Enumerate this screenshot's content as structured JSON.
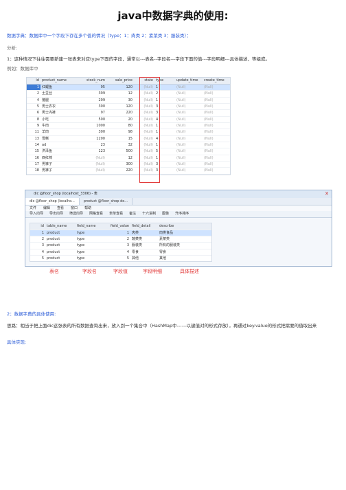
{
  "title": "java中数据字典的使用:",
  "intro": "数据字典：数据库中一个字段下存在多个值的情况（type：1：肉类 2：素菜类 3：服装类）：",
  "analysis_label": "分析:",
  "analysis_text": "1：这种情况下往往需要新建一张表来对应type下面的字段，通常以---表名--字段名---字段下面的值---字段明细---具体描述，等组成。",
  "example_label": "例如：数据库中",
  "table1": {
    "columns": [
      "id",
      "product_name",
      "stock_num",
      "sale_price",
      "state",
      "type",
      "update_time",
      "create_time"
    ],
    "rows": [
      [
        "1",
        "红鲤鱼",
        "95",
        "120",
        "(Null)",
        "1",
        "(Null)",
        "(Null)"
      ],
      [
        "2",
        "土豆丝",
        "399",
        "12",
        "(Null)",
        "2",
        "(Null)",
        "(Null)"
      ],
      [
        "4",
        "猪腿",
        "299",
        "30",
        "(Null)",
        "1",
        "(Null)",
        "(Null)"
      ],
      [
        "5",
        "男士衣衣",
        "300",
        "120",
        "(Null)",
        "3",
        "(Null)",
        "(Null)"
      ],
      [
        "6",
        "男士内裤",
        "97",
        "220",
        "(Null)",
        "3",
        "(Null)",
        "(Null)"
      ],
      [
        "8",
        "小吃",
        "500",
        "20",
        "(Null)",
        "4",
        "(Null)",
        "(Null)"
      ],
      [
        "9",
        "牛肉",
        "1000",
        "80",
        "(Null)",
        "1",
        "(Null)",
        "(Null)"
      ],
      [
        "11",
        "羊肉",
        "300",
        "98",
        "(Null)",
        "1",
        "(Null)",
        "(Null)"
      ],
      [
        "13",
        "雪糕",
        "1200",
        "15",
        "(Null)",
        "4",
        "(Null)",
        "(Null)"
      ],
      [
        "14",
        "ad",
        "23",
        "32",
        "(Null)",
        "1",
        "(Null)",
        "(Null)"
      ],
      [
        "15",
        "洪泽鱼",
        "123",
        "500",
        "(Null)",
        "5",
        "(Null)",
        "(Null)"
      ],
      [
        "16",
        "西红柿",
        "(Null)",
        "12",
        "(Null)",
        "1",
        "(Null)",
        "(Null)"
      ],
      [
        "17",
        "男裤子",
        "(Null)",
        "300",
        "(Null)",
        "3",
        "(Null)",
        "(Null)"
      ],
      [
        "18",
        "男裤子",
        "(Null)",
        "220",
        "(Null)",
        "3",
        "(Null)",
        "(Null)"
      ]
    ]
  },
  "window": {
    "titlebar": "dic @floor_shop (localhost_3306) - 表",
    "tabs": [
      "dic @floor_shop (localho...",
      "product @floor_shop do..."
    ],
    "menu": [
      "文件",
      "编辑",
      "查看",
      "窗口",
      "帮助"
    ],
    "toolbar": [
      "导入向导",
      "导出向导",
      "筛选向导",
      "网格查看",
      "表单查看",
      "备注",
      "十六进制",
      "图像",
      "升序排序"
    ],
    "table2_columns": [
      "id",
      "table_name",
      "field_name",
      "field_value",
      "field_detail",
      "describe"
    ],
    "table2_rows": [
      [
        "1",
        "product",
        "type",
        "1",
        "肉类",
        "肉类食品"
      ],
      [
        "2",
        "product",
        "type",
        "2",
        "蔬菜类",
        "素菜类"
      ],
      [
        "3",
        "product",
        "type",
        "3",
        "服装类",
        "所有的服装类"
      ],
      [
        "4",
        "product",
        "type",
        "4",
        "零食",
        "零食"
      ],
      [
        "5",
        "product",
        "type",
        "5",
        "其他",
        "其他"
      ]
    ]
  },
  "annotations": [
    "表名",
    "字段名",
    "字段值",
    "字段明细",
    "具体描述"
  ],
  "section2_title": "2：数据字典的具体使用:",
  "section2_text": "思路：相当于把上面dic这张表的所有数据查询出来，放入到一个集合中（HashMap中------以键值对的形式存放），再通过key.value的形式把需要的值取出来",
  "section3_title": "具体实现:",
  "colors": {
    "accent": "#2a5bd7",
    "annotation_red": "#e23b3b",
    "selection": "#cfe3ff"
  }
}
